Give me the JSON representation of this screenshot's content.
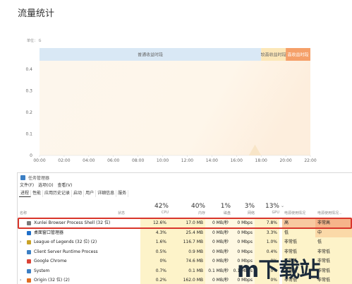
{
  "page": {
    "title": "流量统计"
  },
  "chart_data": {
    "type": "area",
    "ylabel": "单位： G",
    "yticks": [
      "0.4",
      "0.3",
      "0.2",
      "0.1",
      "0"
    ],
    "ylim": [
      0,
      0.4
    ],
    "xticks": [
      "00:00",
      "02:00",
      "04:00",
      "06:00",
      "08:00",
      "10:00",
      "12:00",
      "14:00",
      "16:00",
      "18:00",
      "20:00",
      "22:00"
    ],
    "bands": [
      {
        "label": "普通收益时段",
        "color": "#d9e8f5",
        "from": "00:00",
        "to": "18:00"
      },
      {
        "label": "较高收益时段",
        "color": "#fce7b8",
        "from": "18:00",
        "to": "20:00"
      },
      {
        "label": "高收益时段",
        "color": "#f5a069",
        "from": "20:00",
        "to": "22:00"
      }
    ],
    "series": [
      {
        "values": [
          {
            "x": "17:00",
            "y": 0.0
          },
          {
            "x": "17:30",
            "y": 0.05
          },
          {
            "x": "18:00",
            "y": 0.0
          }
        ]
      }
    ]
  },
  "task_manager": {
    "title": "任务管理器",
    "menu": [
      "文件(F)",
      "选项(O)",
      "查看(V)"
    ],
    "tabs": [
      "进程",
      "性能",
      "应用历史记录",
      "启动",
      "用户",
      "详细信息",
      "服务"
    ],
    "columns": {
      "name": "名称",
      "status": "状态",
      "cpu": {
        "pct": "42%",
        "label": "CPU"
      },
      "memory": {
        "pct": "40%",
        "label": "内存"
      },
      "disk": {
        "pct": "1%",
        "label": "磁盘"
      },
      "network": {
        "pct": "3%",
        "label": "网络"
      },
      "gpu": {
        "pct": "13%",
        "label": "GPU"
      },
      "power": "电源使用情况",
      "power_trend": "电源使用情况..."
    },
    "rows": [
      {
        "expander": "",
        "icon_color": "#7a7a7a",
        "name": "Xunlei Browser Process Shell (32 位)",
        "cpu": "12.6%",
        "memory": "17.0 MB",
        "disk": "0 MB/秒",
        "network": "0 Mbps",
        "gpu": "7.8%",
        "power": "高",
        "power_trend": "非常高",
        "highlighted": true
      },
      {
        "expander": "",
        "icon_color": "#1f6fc9",
        "name": "桌面窗口管理器",
        "cpu": "4.3%",
        "memory": "25.4 MB",
        "disk": "0 MB/秒",
        "network": "0 Mbps",
        "gpu": "3.3%",
        "power": "低",
        "power_trend": "中"
      },
      {
        "expander": "›",
        "icon_color": "#c9a227",
        "name": "League of Legends (32 位) (2)",
        "cpu": "1.6%",
        "memory": "116.7 MB",
        "disk": "0 MB/秒",
        "network": "0 Mbps",
        "gpu": "1.0%",
        "power": "非常低",
        "power_trend": "低"
      },
      {
        "expander": "",
        "icon_color": "#3c7fc4",
        "name": "Client Server Runtime Process",
        "cpu": "0.5%",
        "memory": "0.9 MB",
        "disk": "0 MB/秒",
        "network": "0 Mbps",
        "gpu": "0.4%",
        "power": "非常低",
        "power_trend": "非常低"
      },
      {
        "expander": "",
        "icon_color": "#db4437",
        "name": "Google Chrome",
        "cpu": "0%",
        "memory": "74.6 MB",
        "disk": "0 MB/秒",
        "network": "0 Mbps",
        "gpu": "0%",
        "power": "非常低",
        "power_trend": "非常低"
      },
      {
        "expander": "",
        "icon_color": "#3c7fc4",
        "name": "System",
        "cpu": "0.7%",
        "memory": "0.1 MB",
        "disk": "0.1 MB/秒",
        "network": "0.1 Mbps",
        "gpu": "0%",
        "power": "非常低",
        "power_trend": "非常低"
      },
      {
        "expander": "›",
        "icon_color": "#e06d22",
        "name": "Origin (32 位) (2)",
        "cpu": "0.2%",
        "memory": "162.0 MB",
        "disk": "0 MB/秒",
        "network": "0 Mbps",
        "gpu": "0%",
        "power": "非常低",
        "power_trend": "非常低"
      }
    ]
  },
  "watermark": {
    "text": "m下载站"
  }
}
